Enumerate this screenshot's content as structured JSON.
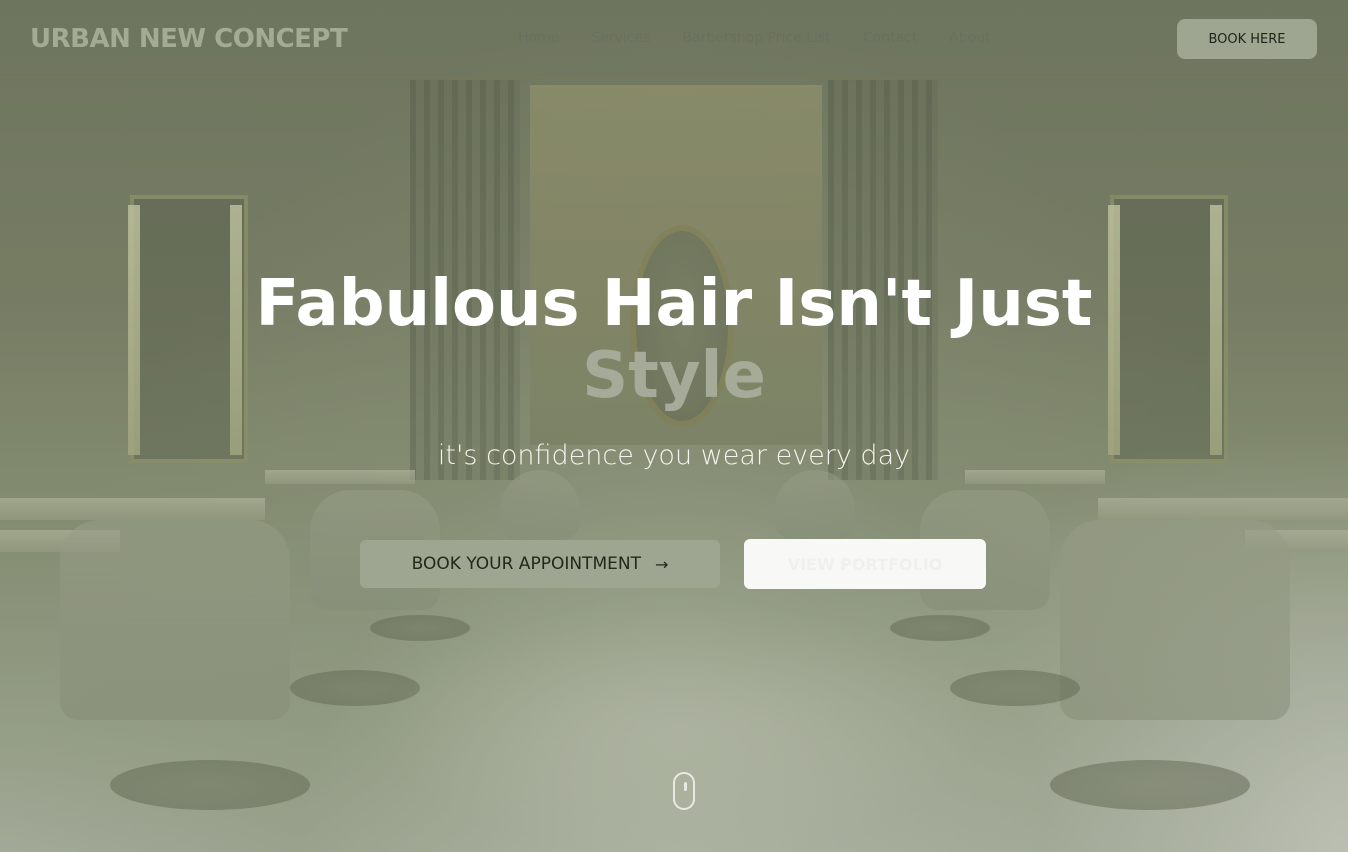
{
  "brand": {
    "logo": "URBAN NEW CONCEPT"
  },
  "nav": {
    "items": [
      {
        "label": "Home"
      },
      {
        "label": "Services"
      },
      {
        "label": "Barbershop Price List"
      },
      {
        "label": "Contact"
      },
      {
        "label": "About"
      }
    ],
    "cta_label": "BOOK HERE"
  },
  "hero": {
    "headline": "Fabulous Hair Isn't Just",
    "headline_accent": "Style",
    "subheadline": "it's confidence you wear every day",
    "primary_button": {
      "label": "BOOK YOUR APPOINTMENT",
      "icon": "arrow-right-icon"
    },
    "secondary_button": {
      "label": "VIEW PORTFOLIO"
    },
    "scroll_icon": "mouse-scroll-icon"
  },
  "colors": {
    "accent": "#9ea590",
    "accent_text": "#a5ab98",
    "headline": "#ffffff"
  }
}
